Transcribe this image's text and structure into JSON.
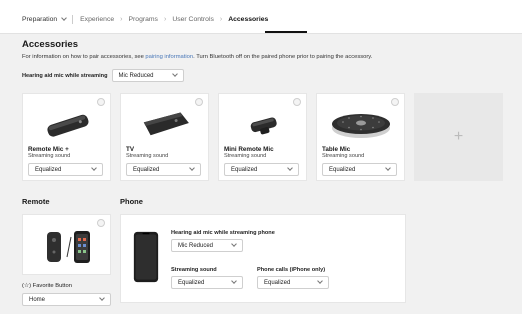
{
  "breadcrumb": {
    "items": [
      {
        "label": "Preparation"
      },
      {
        "label": "Experience"
      },
      {
        "label": "Programs"
      },
      {
        "label": "User Controls"
      },
      {
        "label": "Accessories"
      }
    ]
  },
  "accessories": {
    "title": "Accessories",
    "info_prefix": "For information on how to pair accessories, see ",
    "info_link": "pairing information",
    "info_suffix": ". Turn Bluetooth off on the paired phone prior to pairing the accessory.",
    "mic_label": "Hearing aid mic while streaming",
    "mic_value": "Mic Reduced",
    "cards": [
      {
        "name": "Remote Mic +",
        "sub": "Streaming sound",
        "value": "Equalized"
      },
      {
        "name": "TV",
        "sub": "Streaming sound",
        "value": "Equalized"
      },
      {
        "name": "Mini Remote Mic",
        "sub": "Streaming sound",
        "value": "Equalized"
      },
      {
        "name": "Table Mic",
        "sub": "Streaming sound",
        "value": "Equalized"
      }
    ],
    "add_symbol": "+"
  },
  "remote": {
    "title": "Remote",
    "fav_label": "(☆) Favorite Button",
    "fav_value": "Home"
  },
  "phone": {
    "title": "Phone",
    "mic_label": "Hearing aid mic while streaming phone",
    "mic_value": "Mic Reduced",
    "stream_label": "Streaming sound",
    "stream_value": "Equalized",
    "calls_label": "Phone calls (iPhone only)",
    "calls_value": "Equalized"
  },
  "colors": {
    "link": "#4a78b8",
    "page_bg": "#f1f1f1",
    "card_bg": "#ffffff"
  }
}
